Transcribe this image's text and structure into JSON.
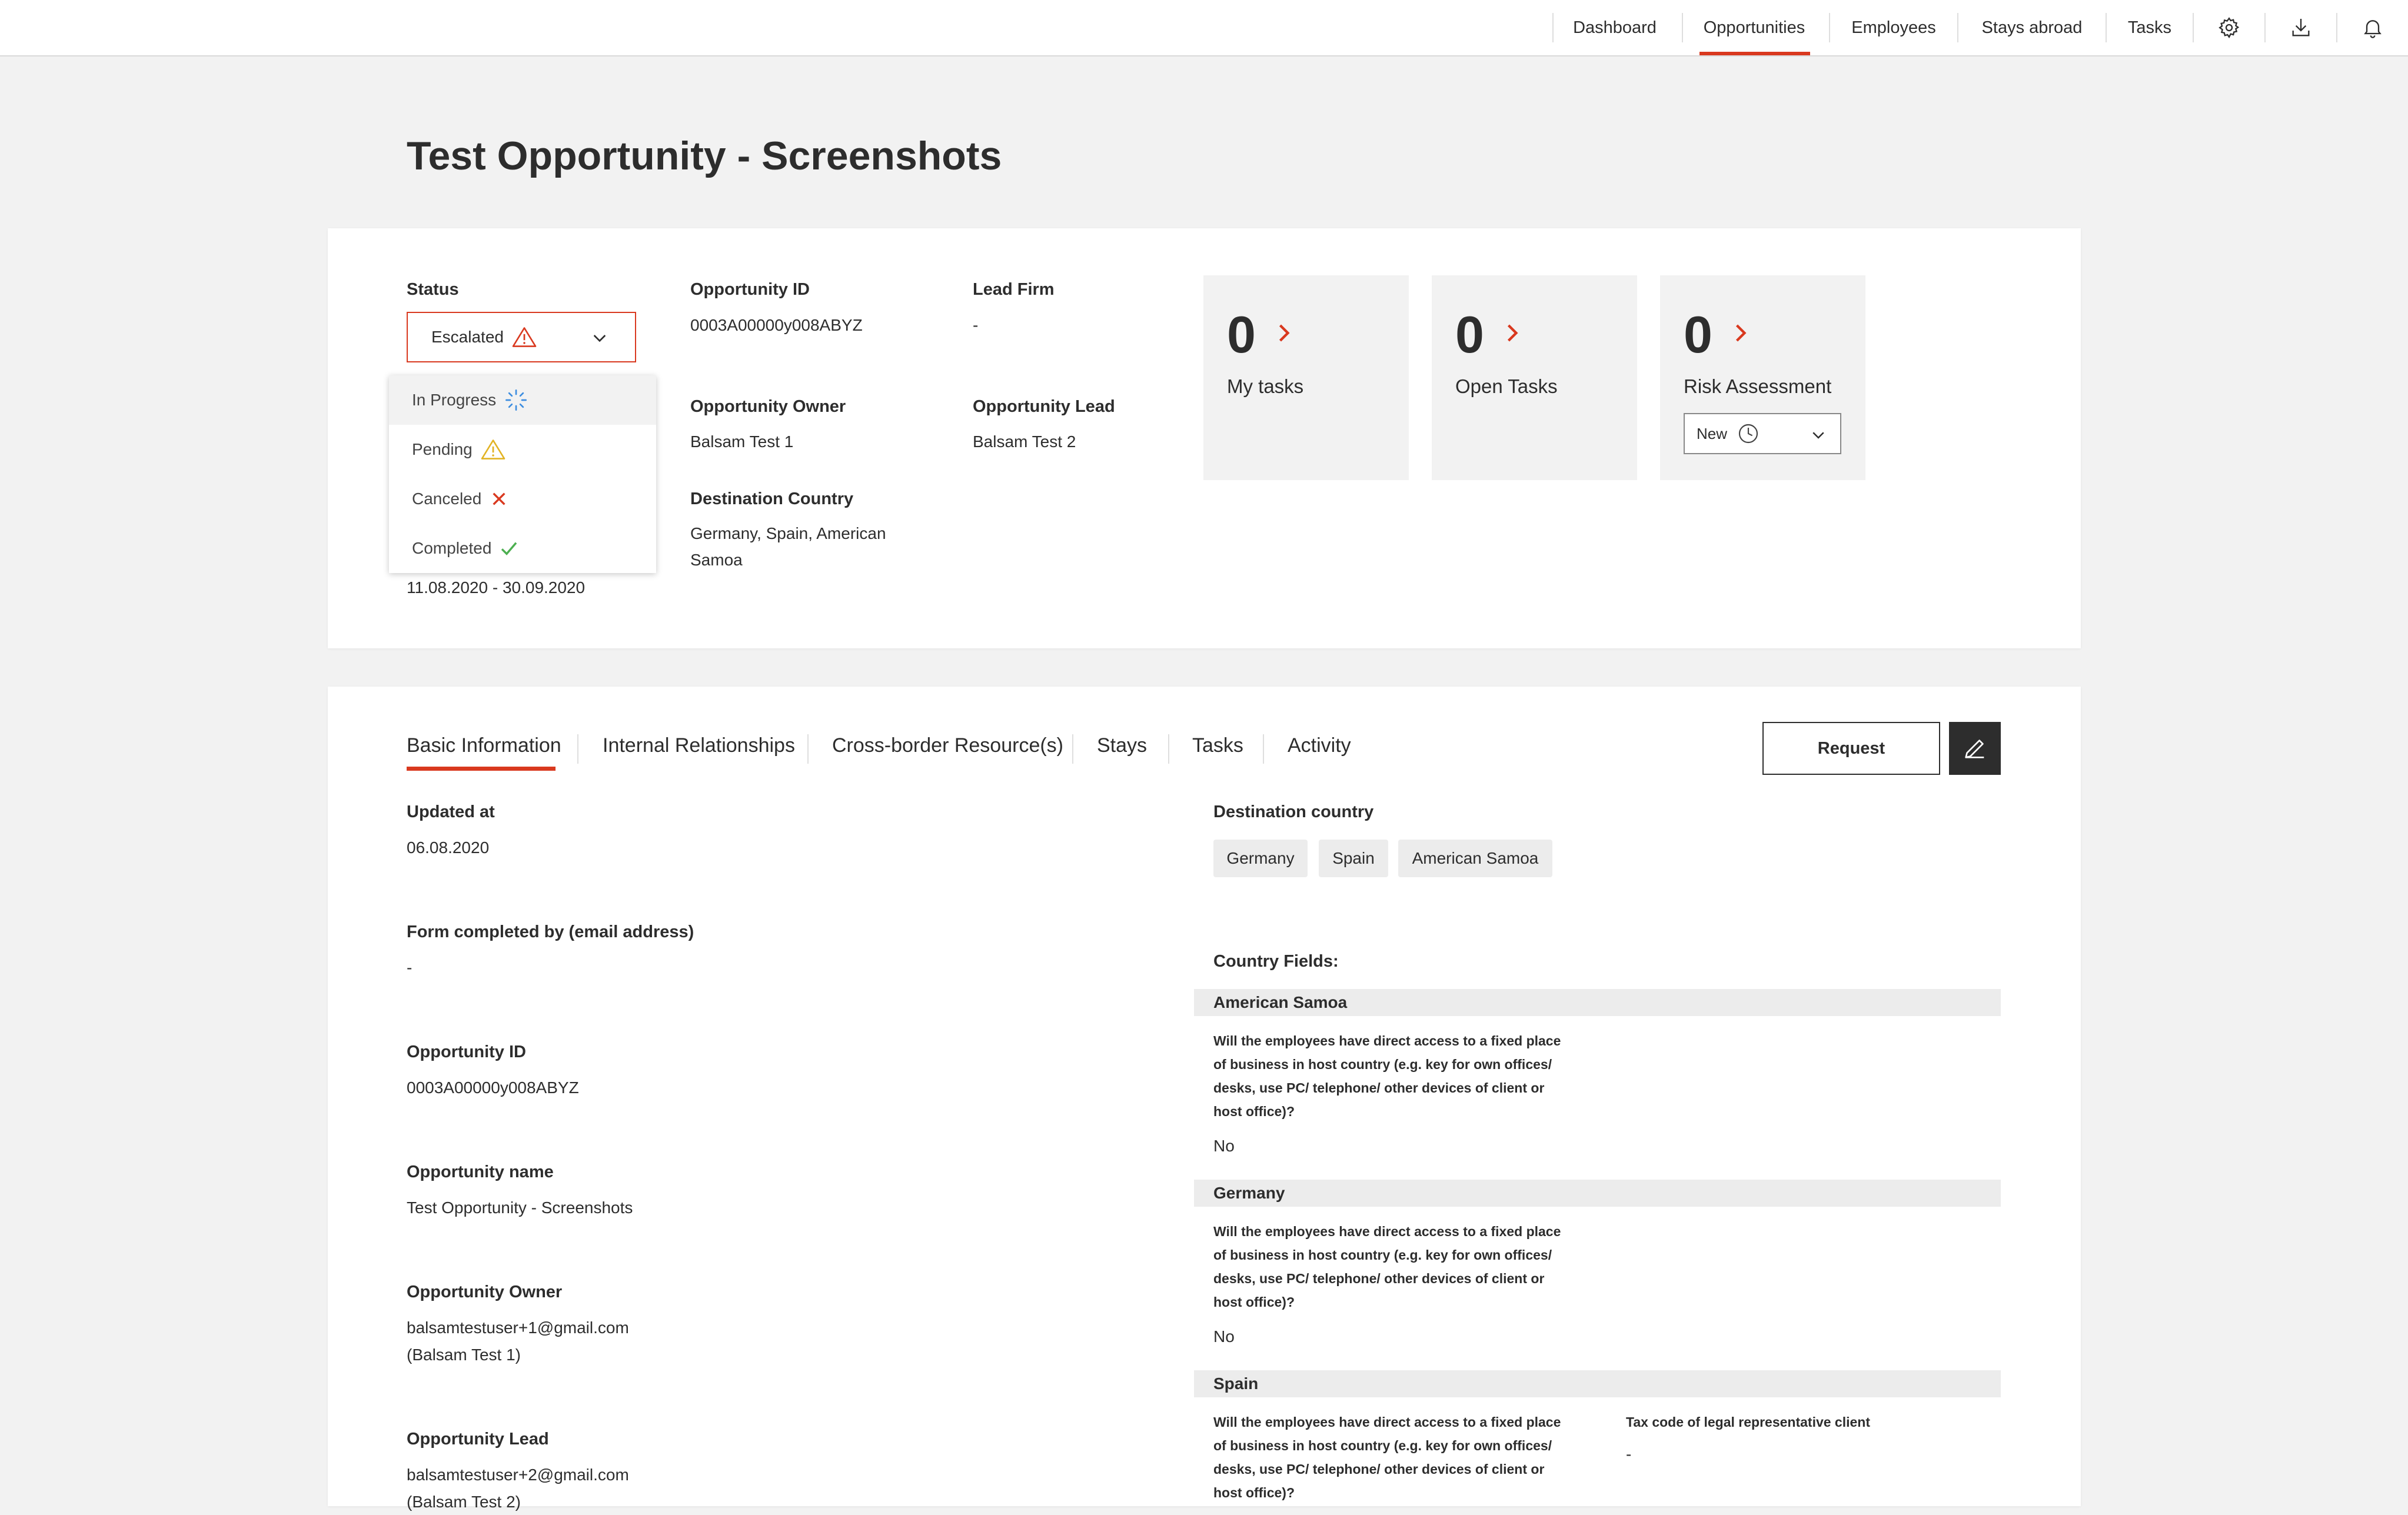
{
  "nav": {
    "items": [
      "Dashboard",
      "Opportunities",
      "Employees",
      "Stays abroad",
      "Tasks"
    ],
    "active": "Opportunities",
    "icons": [
      "gear-icon",
      "download-icon",
      "bell-icon"
    ]
  },
  "page": {
    "title": "Test Opportunity - Screenshots"
  },
  "summary": {
    "status_label": "Status",
    "status_value": "Escalated",
    "status_options": [
      {
        "label": "In Progress",
        "icon": "spinner-icon"
      },
      {
        "label": "Pending",
        "icon": "warning-icon"
      },
      {
        "label": "Canceled",
        "icon": "x-icon"
      },
      {
        "label": "Completed",
        "icon": "check-icon"
      }
    ],
    "date_range": "11.08.2020 - 30.09.2020",
    "opportunity_id_label": "Opportunity ID",
    "opportunity_id": "0003A00000y008ABYZ",
    "lead_firm_label": "Lead Firm",
    "lead_firm": "-",
    "owner_label": "Opportunity Owner",
    "owner": "Balsam Test 1",
    "lead_label": "Opportunity Lead",
    "lead": "Balsam Test 2",
    "destination_label": "Destination Country",
    "destination_line1": "Germany, Spain, American",
    "destination_line2": "Samoa"
  },
  "tiles": {
    "my_tasks": {
      "count": "0",
      "label": "My tasks"
    },
    "open_tasks": {
      "count": "0",
      "label": "Open Tasks"
    },
    "risk": {
      "count": "0",
      "label": "Risk Assessment",
      "select_value": "New"
    }
  },
  "tabs": [
    "Basic Information",
    "Internal Relationships",
    "Cross-border Resource(s)",
    "Stays",
    "Tasks",
    "Activity"
  ],
  "active_tab": "Basic Information",
  "actions": {
    "request_label": "Request",
    "edit_icon": "pencil-icon"
  },
  "basic": {
    "updated_label": "Updated at",
    "updated_value": "06.08.2020",
    "form_label": "Form completed by (email address)",
    "form_value": "-",
    "opp_id_label": "Opportunity ID",
    "opp_id_value": "0003A00000y008ABYZ",
    "opp_name_label": "Opportunity name",
    "opp_name_value": "Test Opportunity - Screenshots",
    "owner_label": "Opportunity Owner",
    "owner_email": "balsamtestuser+1@gmail.com",
    "owner_name": "(Balsam Test 1)",
    "lead_label": "Opportunity Lead",
    "lead_email": "balsamtestuser+2@gmail.com",
    "lead_name": "(Balsam Test 2)"
  },
  "destination": {
    "label": "Destination country",
    "chips": [
      "Germany",
      "Spain",
      "American Samoa"
    ],
    "country_fields_label": "Country Fields:",
    "question_lines": [
      "Will the employees have direct access to a fixed place",
      "of business in host country (e.g. key for own offices/",
      "desks, use PC/ telephone/ other devices of client or",
      "host office)?"
    ],
    "countries": [
      {
        "name": "American Samoa",
        "answer": "No"
      },
      {
        "name": "Germany",
        "answer": "No"
      },
      {
        "name": "Spain",
        "extra_label": "Tax code of legal representative client",
        "extra_value": "-"
      }
    ]
  }
}
